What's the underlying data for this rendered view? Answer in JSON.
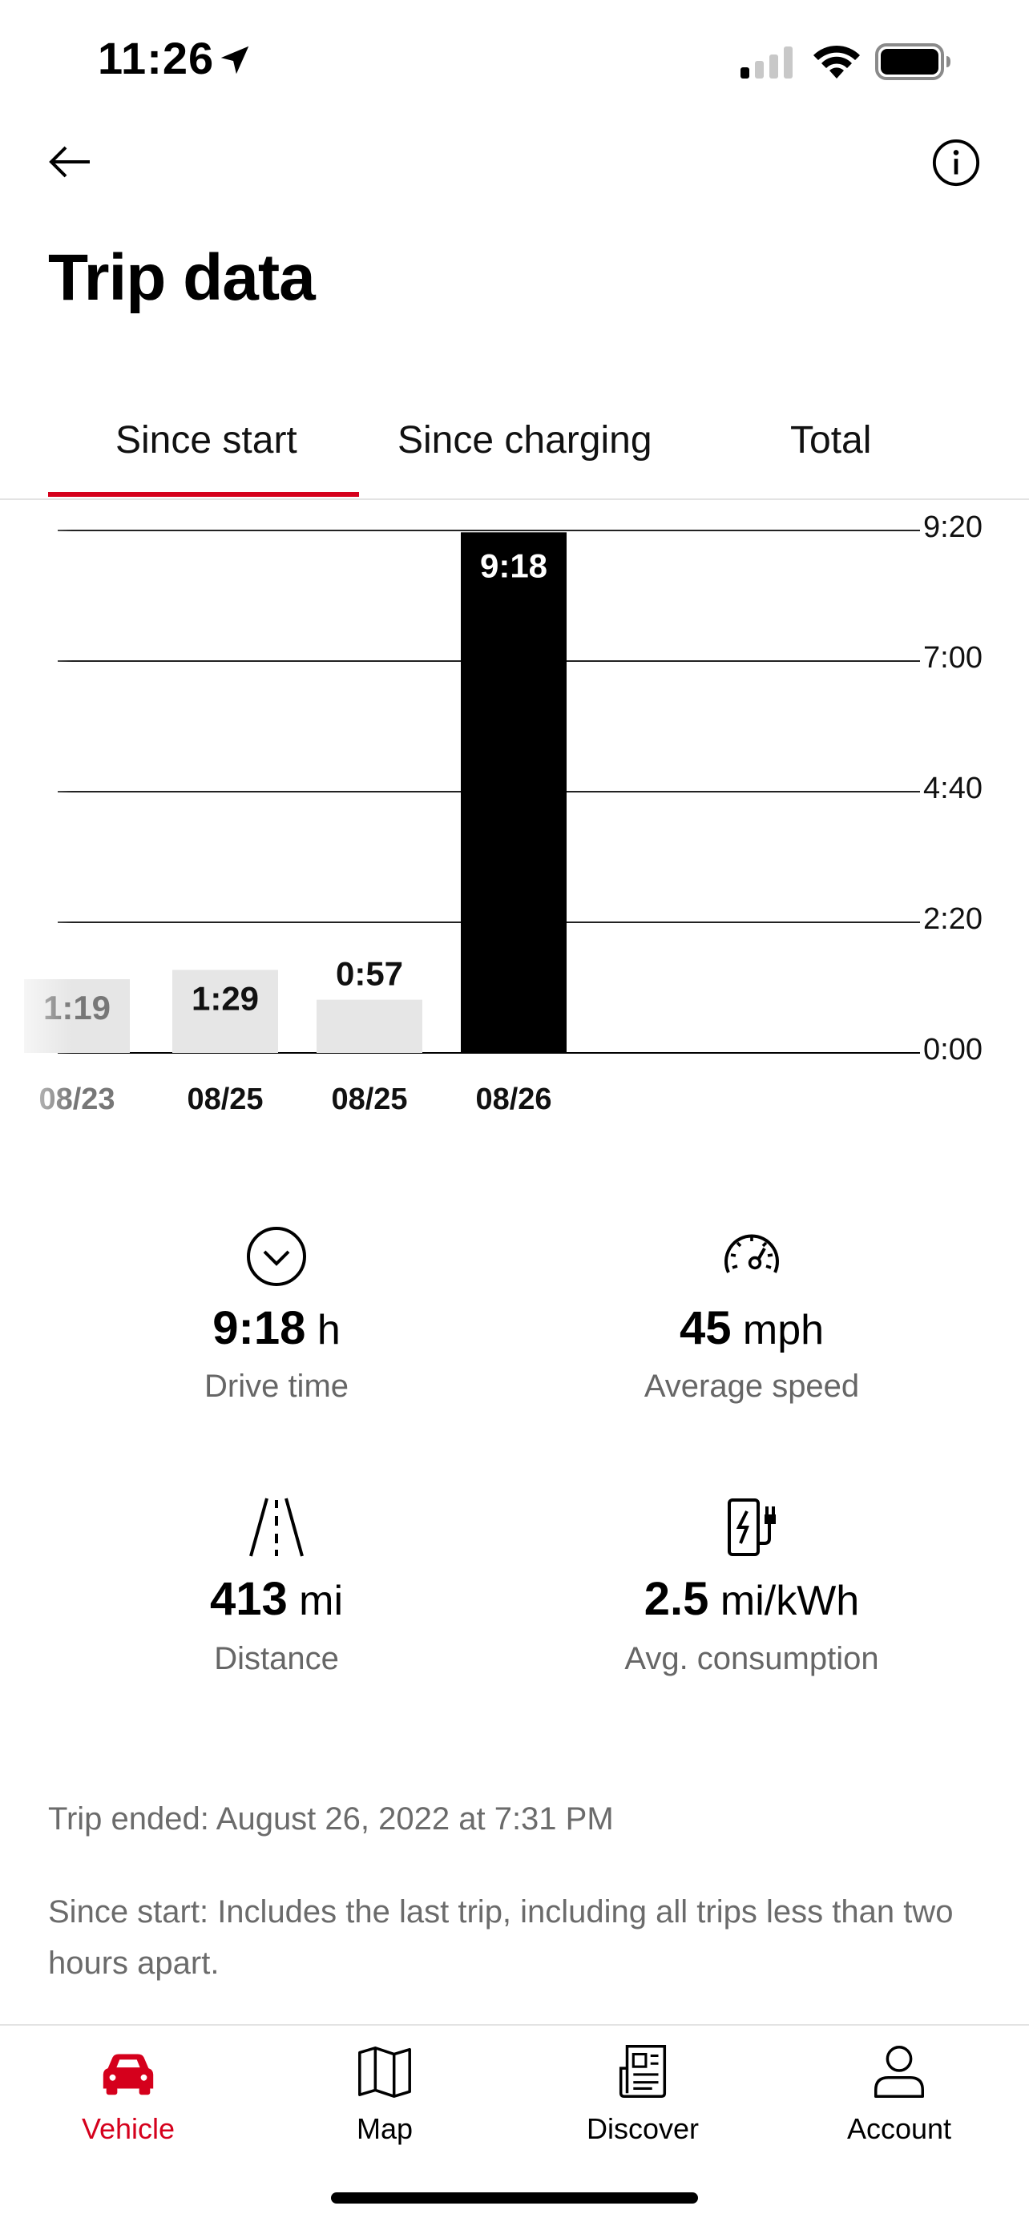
{
  "status_bar": {
    "time": "11:26"
  },
  "header": {
    "title": "Trip data"
  },
  "tabs": [
    {
      "label": "Since start",
      "active": true
    },
    {
      "label": "Since charging",
      "active": false
    },
    {
      "label": "Total",
      "active": false
    }
  ],
  "chart_data": {
    "type": "bar",
    "categories": [
      "08/23",
      "08/25",
      "08/25",
      "08/26"
    ],
    "values": [
      "1:19",
      "1:29",
      "0:57",
      "9:18"
    ],
    "values_minutes": [
      79,
      89,
      57,
      558
    ],
    "highlighted_index": 3,
    "ytick_labels": [
      "0:00",
      "2:20",
      "4:40",
      "7:00",
      "9:20"
    ],
    "ylim_minutes": [
      0,
      560
    ],
    "grid": true,
    "colors": {
      "bar": "#e6e6e6",
      "highlight": "#000000",
      "highlight_text": "#ffffff"
    }
  },
  "stats": {
    "drive_time": {
      "value": "9:18",
      "unit": "h",
      "label": "Drive time",
      "icon": "clock-chevron-icon"
    },
    "average_speed": {
      "value": "45",
      "unit": "mph",
      "label": "Average speed",
      "icon": "speedometer-icon"
    },
    "distance": {
      "value": "413",
      "unit": "mi",
      "label": "Distance",
      "icon": "road-icon"
    },
    "avg_consumption": {
      "value": "2.5",
      "unit": "mi/kWh",
      "label": "Avg. consumption",
      "icon": "charging-station-icon"
    }
  },
  "trip_ended": "Trip ended: August 26, 2022 at 7:31 PM",
  "since_start_note": "Since start: Includes the last trip, including all trips less than two hours apart.",
  "bottom_nav": [
    {
      "label": "Vehicle",
      "icon": "car-icon",
      "active": true
    },
    {
      "label": "Map",
      "icon": "map-icon",
      "active": false
    },
    {
      "label": "Discover",
      "icon": "news-icon",
      "active": false
    },
    {
      "label": "Account",
      "icon": "person-icon",
      "active": false
    }
  ],
  "colors": {
    "accent": "#d5001c",
    "muted_text": "#666666"
  }
}
